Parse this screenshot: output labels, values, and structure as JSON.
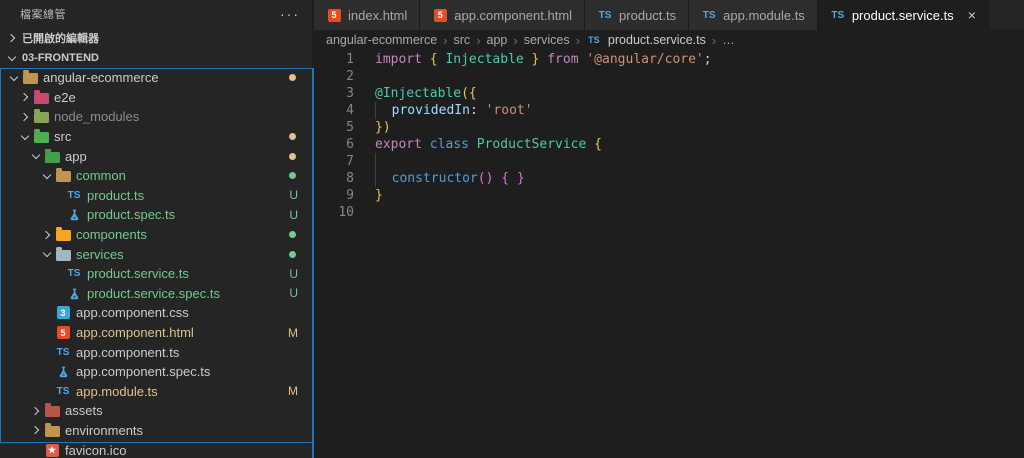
{
  "colors": {
    "untracked": "#73C991",
    "modified": "#E2C08D",
    "ignored": "#8C8C8C",
    "default": "#CCCCCC",
    "focus_border": "#2077B4",
    "folders": {
      "folder-root": "#C09553",
      "folder-e2e": "#C74B6E",
      "folder-node": "#87A556",
      "folder-src": "#4CAF50",
      "folder-app": "#43A047",
      "folder": "#C09553",
      "folder-components": "#F6A623",
      "folder-services": "#9FB6C3",
      "folder-assets": "#B5574D"
    },
    "icon_html_bg": "#E44D26",
    "icon_css_bg": "#33A9DC",
    "icon_favicon_bg": "#E25A45",
    "icon_ts_fg": "#4FA8E8"
  },
  "sidebar": {
    "title": "檔案總管",
    "actions_label": "···",
    "sections": [
      {
        "label": "已開啟的編輯器",
        "expanded": false
      },
      {
        "label": "03-FRONTEND",
        "expanded": true
      }
    ],
    "tree": [
      {
        "name": "angular-ecommerce",
        "kind": "folder",
        "depth": 0,
        "expanded": true,
        "icon": "folder-root",
        "color": "default",
        "badge": "dot",
        "badge_color": "modified"
      },
      {
        "name": "e2e",
        "kind": "folder",
        "depth": 1,
        "expanded": false,
        "icon": "folder-e2e",
        "color": "default",
        "badge": null
      },
      {
        "name": "node_modules",
        "kind": "folder",
        "depth": 1,
        "expanded": false,
        "icon": "folder-node",
        "color": "ignored",
        "badge": null
      },
      {
        "name": "src",
        "kind": "folder",
        "depth": 1,
        "expanded": true,
        "icon": "folder-src",
        "color": "default",
        "badge": "dot",
        "badge_color": "modified"
      },
      {
        "name": "app",
        "kind": "folder",
        "depth": 2,
        "expanded": true,
        "icon": "folder-app",
        "color": "default",
        "badge": "dot",
        "badge_color": "modified"
      },
      {
        "name": "common",
        "kind": "folder",
        "depth": 3,
        "expanded": true,
        "icon": "folder",
        "color": "untracked",
        "badge": "dot",
        "badge_color": "untracked"
      },
      {
        "name": "product.ts",
        "kind": "file",
        "depth": 4,
        "icon": "ts",
        "color": "untracked",
        "badge": "U",
        "badge_color": "untracked"
      },
      {
        "name": "product.spec.ts",
        "kind": "file",
        "depth": 4,
        "icon": "spec",
        "color": "untracked",
        "badge": "U",
        "badge_color": "untracked"
      },
      {
        "name": "components",
        "kind": "folder",
        "depth": 3,
        "expanded": false,
        "icon": "folder-components",
        "color": "untracked",
        "badge": "dot",
        "badge_color": "untracked"
      },
      {
        "name": "services",
        "kind": "folder",
        "depth": 3,
        "expanded": true,
        "icon": "folder-services",
        "color": "untracked",
        "badge": "dot",
        "badge_color": "untracked"
      },
      {
        "name": "product.service.ts",
        "kind": "file",
        "depth": 4,
        "icon": "ts",
        "color": "untracked",
        "badge": "U",
        "badge_color": "untracked"
      },
      {
        "name": "product.service.spec.ts",
        "kind": "file",
        "depth": 4,
        "icon": "spec",
        "color": "untracked",
        "badge": "U",
        "badge_color": "untracked"
      },
      {
        "name": "app.component.css",
        "kind": "file",
        "depth": 3,
        "icon": "css",
        "color": "default",
        "badge": null
      },
      {
        "name": "app.component.html",
        "kind": "file",
        "depth": 3,
        "icon": "html",
        "color": "modified",
        "badge": "M",
        "badge_color": "modified"
      },
      {
        "name": "app.component.ts",
        "kind": "file",
        "depth": 3,
        "icon": "ts",
        "color": "default",
        "badge": null
      },
      {
        "name": "app.component.spec.ts",
        "kind": "file",
        "depth": 3,
        "icon": "spec",
        "color": "default",
        "badge": null
      },
      {
        "name": "app.module.ts",
        "kind": "file",
        "depth": 3,
        "icon": "ts",
        "color": "modified",
        "badge": "M",
        "badge_color": "modified"
      },
      {
        "name": "assets",
        "kind": "folder",
        "depth": 2,
        "expanded": false,
        "icon": "folder-assets",
        "color": "default",
        "badge": null
      },
      {
        "name": "environments",
        "kind": "folder",
        "depth": 2,
        "expanded": false,
        "icon": "folder",
        "color": "default",
        "badge": null
      },
      {
        "name": "favicon.ico",
        "kind": "file",
        "depth": 2,
        "icon": "favicon",
        "color": "default",
        "badge": null
      }
    ]
  },
  "tabs": [
    {
      "label": "index.html",
      "icon": "html",
      "active": false
    },
    {
      "label": "app.component.html",
      "icon": "html",
      "active": false
    },
    {
      "label": "product.ts",
      "icon": "ts",
      "active": false
    },
    {
      "label": "app.module.ts",
      "icon": "ts",
      "active": false
    },
    {
      "label": "product.service.ts",
      "icon": "ts",
      "active": true,
      "close_label": "×"
    }
  ],
  "breadcrumb": {
    "items": [
      "angular-ecommerce",
      "src",
      "app",
      "services"
    ],
    "separator": "›",
    "file": "product.service.ts",
    "file_icon": "ts",
    "tail": "…"
  },
  "editor": {
    "lines": [
      {
        "n": "1",
        "tokens": [
          [
            "kw",
            "import "
          ],
          [
            "b1",
            "{ "
          ],
          [
            "type",
            "Injectable"
          ],
          [
            "b1",
            " } "
          ],
          [
            "kw",
            "from "
          ],
          [
            "str",
            "'@angular/core'"
          ],
          [
            "fg",
            ";"
          ]
        ]
      },
      {
        "n": "2",
        "tokens": []
      },
      {
        "n": "3",
        "tokens": [
          [
            "type",
            "@Injectable"
          ],
          [
            "b1",
            "({"
          ]
        ]
      },
      {
        "n": "4",
        "tokens": [
          [
            "guide",
            "  "
          ],
          [
            "prop",
            "providedIn"
          ],
          [
            "fg",
            ": "
          ],
          [
            "str",
            "'root'"
          ]
        ]
      },
      {
        "n": "5",
        "tokens": [
          [
            "b1",
            "})"
          ]
        ]
      },
      {
        "n": "6",
        "tokens": [
          [
            "kw",
            "export "
          ],
          [
            "kw2",
            "class "
          ],
          [
            "type",
            "ProductService"
          ],
          [
            "fg",
            " "
          ],
          [
            "b1",
            "{"
          ]
        ]
      },
      {
        "n": "7",
        "tokens": [
          [
            "guide",
            "  "
          ]
        ]
      },
      {
        "n": "8",
        "tokens": [
          [
            "guide",
            "  "
          ],
          [
            "kw2",
            "constructor"
          ],
          [
            "b2",
            "()"
          ],
          [
            "fg",
            " "
          ],
          [
            "b2",
            "{ }"
          ]
        ]
      },
      {
        "n": "9",
        "tokens": [
          [
            "b1",
            "}"
          ]
        ]
      },
      {
        "n": "10",
        "tokens": []
      }
    ]
  }
}
